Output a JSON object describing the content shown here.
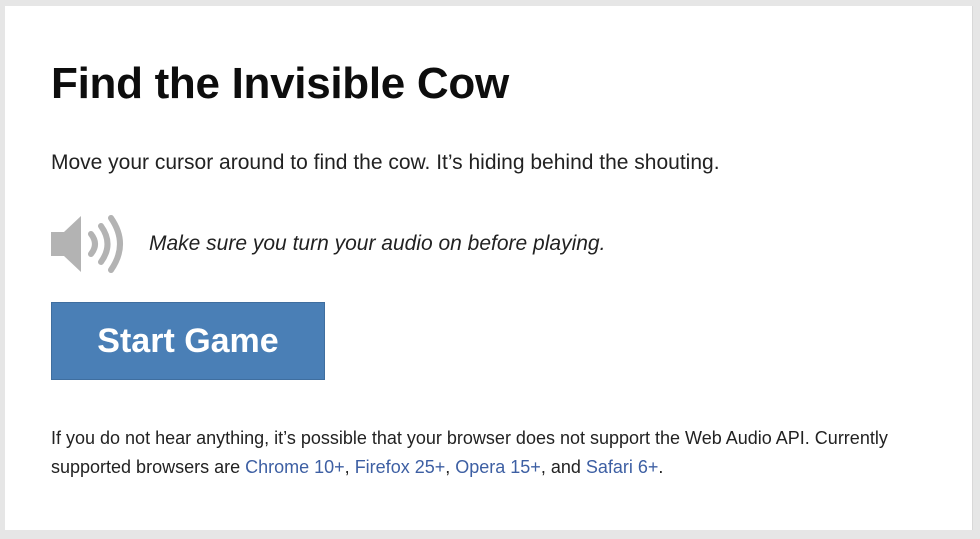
{
  "page": {
    "title": "Find the Invisible Cow",
    "intro": "Move your cursor around to find the cow. It’s hiding behind the shouting."
  },
  "audio": {
    "icon": "speaker-volume-icon",
    "note": "Make sure you turn your audio on before playing."
  },
  "start_button": {
    "label": "Start Game"
  },
  "support": {
    "text_before": "If you do not hear anything, it’s possible that your browser does not support the Web Audio API. Currently supported browsers are ",
    "links": [
      {
        "label": "Chrome 10+"
      },
      {
        "label": "Firefox 25+"
      },
      {
        "label": "Opera 15+"
      },
      {
        "label": "Safari 6+"
      }
    ],
    "sep_1": ", ",
    "sep_2": ", ",
    "sep_3": ", and ",
    "text_after": "."
  },
  "colors": {
    "button": "#4a7fb6",
    "link": "#3d5fa3",
    "icon": "#b3b3b3",
    "background": "#e6e6e6"
  }
}
